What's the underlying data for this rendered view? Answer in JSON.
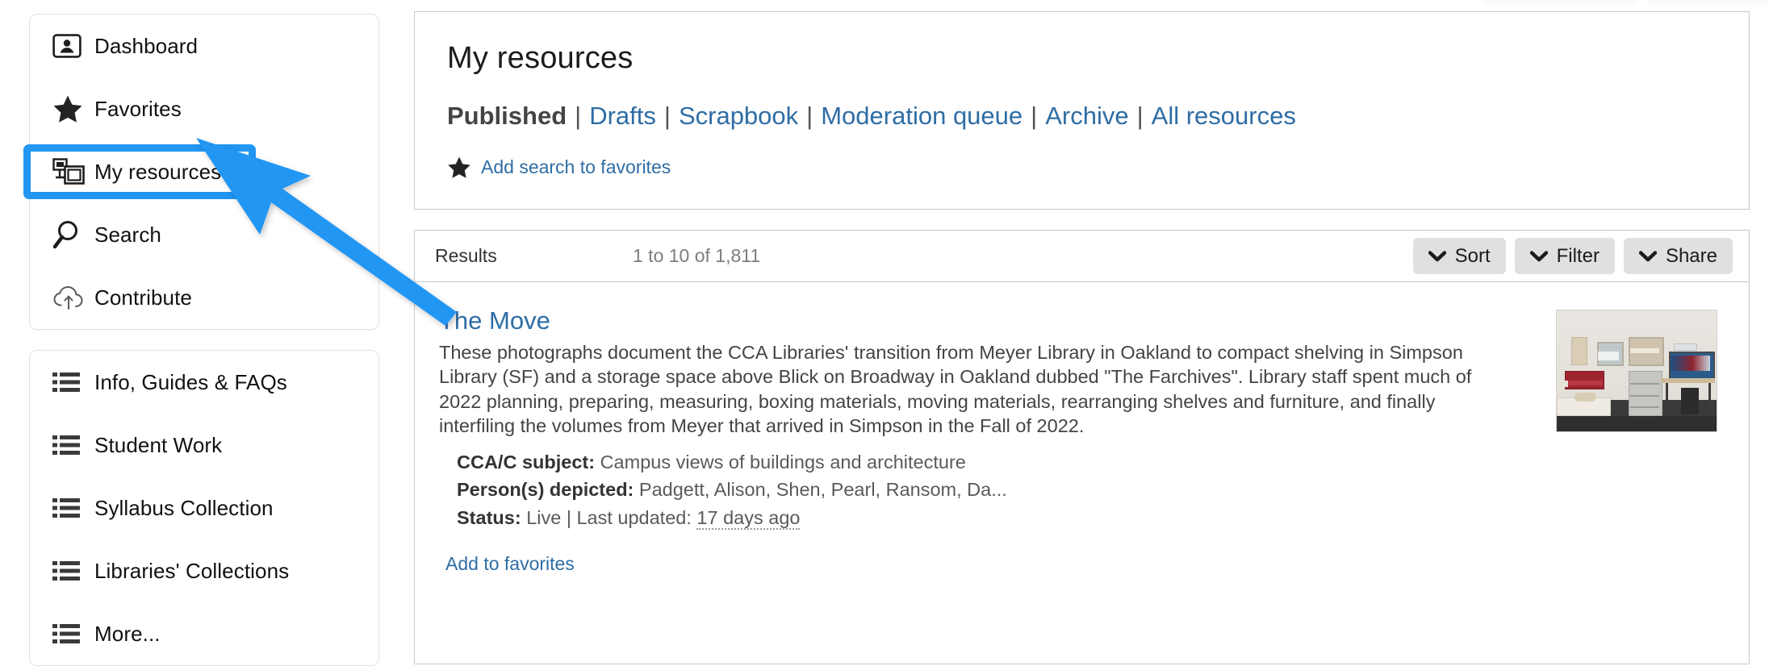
{
  "sidebar": {
    "primary_items": [
      {
        "label": "Dashboard",
        "icon": "contact-card-icon"
      },
      {
        "label": "Favorites",
        "icon": "star-icon"
      },
      {
        "label": "My resources",
        "icon": "resources-icon",
        "highlighted": true
      },
      {
        "label": "Search",
        "icon": "magnifier-icon"
      },
      {
        "label": "Contribute",
        "icon": "cloud-upload-icon"
      }
    ],
    "secondary_items": [
      {
        "label": "Info, Guides & FAQs",
        "icon": "list-icon"
      },
      {
        "label": "Student Work",
        "icon": "list-icon"
      },
      {
        "label": "Syllabus Collection",
        "icon": "list-icon"
      },
      {
        "label": "Libraries' Collections",
        "icon": "list-icon"
      },
      {
        "label": "More...",
        "icon": "list-icon"
      }
    ]
  },
  "header": {
    "title": "My resources",
    "tabs": [
      {
        "label": "Published",
        "active": true
      },
      {
        "label": "Drafts",
        "active": false
      },
      {
        "label": "Scrapbook",
        "active": false
      },
      {
        "label": "Moderation queue",
        "active": false
      },
      {
        "label": "Archive",
        "active": false
      },
      {
        "label": "All resources",
        "active": false
      }
    ],
    "tab_separator": "|",
    "add_search_to_favorites": "Add search to favorites"
  },
  "results": {
    "label": "Results",
    "count_text": "1 to 10 of 1,811",
    "actions": [
      {
        "label": "Sort",
        "icon": "chevron-down-icon"
      },
      {
        "label": "Filter",
        "icon": "chevron-down-icon"
      },
      {
        "label": "Share",
        "icon": "chevron-down-icon"
      }
    ],
    "items": [
      {
        "title": "The Move",
        "description": "These photographs document the CCA Libraries' transition from Meyer Library in Oakland to compact shelving in Simpson Library (SF) and a storage space above Blick on Broadway in Oakland dubbed \"The Farchives\". Library staff spent much of 2022 planning, preparing, measuring, boxing materials, moving materials, rearranging shelves and furniture, and finally interfiling the volumes from Meyer that arrived in Simpson in the Fall of 2022.",
        "meta": {
          "subject_key": "CCA/C subject:",
          "subject_value": "Campus views of buildings and architecture",
          "persons_key": "Person(s) depicted:",
          "persons_value": "Padgett, Alison, Shen, Pearl, Ransom, Da...",
          "status_key": "Status:",
          "status_value": "Live | Last updated:",
          "status_updated": "17 days ago"
        },
        "add_to_favorites": "Add to favorites",
        "thumbnail_alt": "library-room-photo"
      }
    ]
  },
  "annotation": {
    "highlight_color": "#2196f3",
    "arrow_color": "#2196f3",
    "target": "My resources"
  },
  "colors": {
    "link": "#2e6da4",
    "active_tab": "#444444",
    "muted_text": "#7d7d7d",
    "button_bg": "#e0e0e0",
    "panel_border": "#c9c9c9"
  }
}
